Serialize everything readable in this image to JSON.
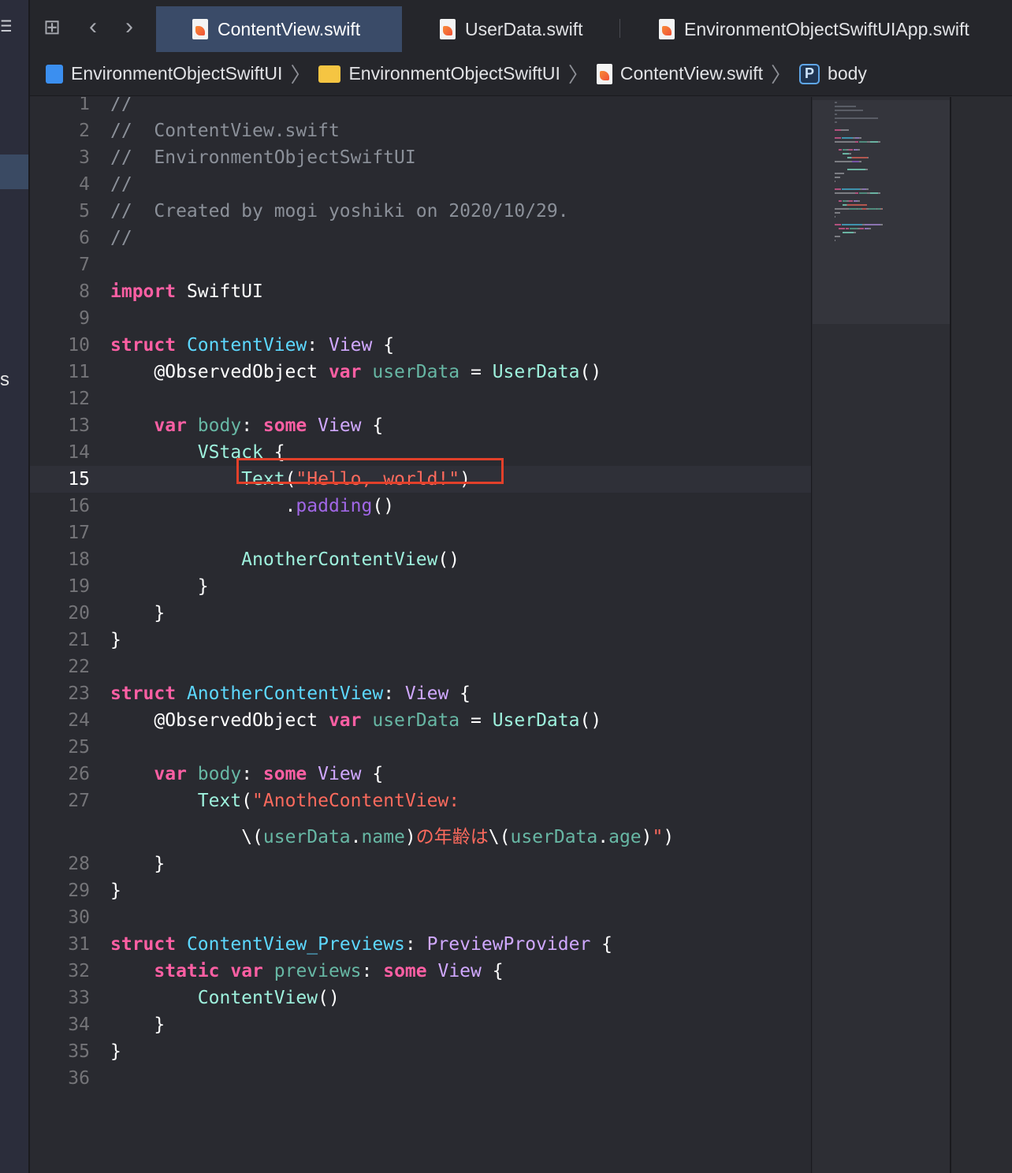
{
  "tabs": [
    {
      "label": "ContentView.swift",
      "active": true
    },
    {
      "label": "UserData.swift",
      "active": false
    },
    {
      "label": "EnvironmentObjectSwiftUIApp.swift",
      "active": false
    }
  ],
  "toolbar_icons": [
    "grid-icon",
    "back-chevron-icon",
    "forward-chevron-icon"
  ],
  "breadcrumb": [
    "EnvironmentObjectSwiftUI",
    "EnvironmentObjectSwiftUI",
    "ContentView.swift",
    "body"
  ],
  "breadcrumb_symbol_letter": "P",
  "left_rail_text": "s",
  "current_line": "15",
  "colors": {
    "keyword": "#fc5fa3",
    "type": "#5dd8ff",
    "string": "#fc6a5d",
    "comment": "#8b9099",
    "highlight_box": "#e2402a",
    "active_tab": "#3a4b68"
  },
  "code": [
    {
      "n": "1",
      "t": [
        [
          "c-com",
          "//"
        ]
      ]
    },
    {
      "n": "2",
      "t": [
        [
          "c-com",
          "//  ContentView.swift"
        ]
      ]
    },
    {
      "n": "3",
      "t": [
        [
          "c-com",
          "//  EnvironmentObjectSwiftUI"
        ]
      ]
    },
    {
      "n": "4",
      "t": [
        [
          "c-com",
          "//"
        ]
      ]
    },
    {
      "n": "5",
      "t": [
        [
          "c-com",
          "//  Created by mogi yoshiki on 2020/10/29."
        ]
      ]
    },
    {
      "n": "6",
      "t": [
        [
          "c-com",
          "//"
        ]
      ]
    },
    {
      "n": "7",
      "t": []
    },
    {
      "n": "8",
      "t": [
        [
          "c-kw",
          "import"
        ],
        [
          "c-plain",
          " SwiftUI"
        ]
      ]
    },
    {
      "n": "9",
      "t": []
    },
    {
      "n": "10",
      "t": [
        [
          "c-kw",
          "struct"
        ],
        [
          "c-plain",
          " "
        ],
        [
          "c-type",
          "ContentView"
        ],
        [
          "c-plain",
          ": "
        ],
        [
          "c-type2",
          "View"
        ],
        [
          "c-plain",
          " {"
        ]
      ]
    },
    {
      "n": "11",
      "t": [
        [
          "c-plain",
          "    @ObservedObject "
        ],
        [
          "c-kw",
          "var"
        ],
        [
          "c-plain",
          " "
        ],
        [
          "c-var",
          "userData"
        ],
        [
          "c-plain",
          " = "
        ],
        [
          "c-call",
          "UserData"
        ],
        [
          "c-plain",
          "()"
        ]
      ]
    },
    {
      "n": "12",
      "t": []
    },
    {
      "n": "13",
      "t": [
        [
          "c-plain",
          "    "
        ],
        [
          "c-kw",
          "var"
        ],
        [
          "c-plain",
          " "
        ],
        [
          "c-var",
          "body"
        ],
        [
          "c-plain",
          ": "
        ],
        [
          "c-kw",
          "some"
        ],
        [
          "c-plain",
          " "
        ],
        [
          "c-type2",
          "View"
        ],
        [
          "c-plain",
          " {"
        ]
      ]
    },
    {
      "n": "14",
      "t": [
        [
          "c-plain",
          "        "
        ],
        [
          "c-call",
          "VStack"
        ],
        [
          "c-plain",
          " {"
        ]
      ]
    },
    {
      "n": "15",
      "t": [
        [
          "c-plain",
          "            "
        ],
        [
          "c-call",
          "Text"
        ],
        [
          "c-plain",
          "("
        ],
        [
          "c-str",
          "\"Hello, world!\""
        ],
        [
          "c-plain",
          ")"
        ]
      ]
    },
    {
      "n": "16",
      "t": [
        [
          "c-plain",
          "                ."
        ],
        [
          "c-fn",
          "padding"
        ],
        [
          "c-plain",
          "()"
        ]
      ]
    },
    {
      "n": "17",
      "t": []
    },
    {
      "n": "18",
      "t": [
        [
          "c-plain",
          "            "
        ],
        [
          "c-call",
          "AnotherContentView"
        ],
        [
          "c-plain",
          "()"
        ]
      ]
    },
    {
      "n": "19",
      "t": [
        [
          "c-plain",
          "        }"
        ]
      ]
    },
    {
      "n": "20",
      "t": [
        [
          "c-plain",
          "    }"
        ]
      ]
    },
    {
      "n": "21",
      "t": [
        [
          "c-plain",
          "}"
        ]
      ]
    },
    {
      "n": "22",
      "t": []
    },
    {
      "n": "23",
      "t": [
        [
          "c-kw",
          "struct"
        ],
        [
          "c-plain",
          " "
        ],
        [
          "c-type",
          "AnotherContentView"
        ],
        [
          "c-plain",
          ": "
        ],
        [
          "c-type2",
          "View"
        ],
        [
          "c-plain",
          " {"
        ]
      ]
    },
    {
      "n": "24",
      "t": [
        [
          "c-plain",
          "    @ObservedObject "
        ],
        [
          "c-kw",
          "var"
        ],
        [
          "c-plain",
          " "
        ],
        [
          "c-var",
          "userData"
        ],
        [
          "c-plain",
          " = "
        ],
        [
          "c-call",
          "UserData"
        ],
        [
          "c-plain",
          "()"
        ]
      ]
    },
    {
      "n": "25",
      "t": []
    },
    {
      "n": "26",
      "t": [
        [
          "c-plain",
          "    "
        ],
        [
          "c-kw",
          "var"
        ],
        [
          "c-plain",
          " "
        ],
        [
          "c-var",
          "body"
        ],
        [
          "c-plain",
          ": "
        ],
        [
          "c-kw",
          "some"
        ],
        [
          "c-plain",
          " "
        ],
        [
          "c-type2",
          "View"
        ],
        [
          "c-plain",
          " {"
        ]
      ]
    },
    {
      "n": "27",
      "t": [
        [
          "c-plain",
          "        "
        ],
        [
          "c-call",
          "Text"
        ],
        [
          "c-plain",
          "("
        ],
        [
          "c-str",
          "\"AnotheContentView:"
        ]
      ]
    },
    {
      "n": "",
      "t": [
        [
          "c-plain",
          "            \\("
        ],
        [
          "c-var",
          "userData"
        ],
        [
          "c-plain",
          "."
        ],
        [
          "c-var",
          "name"
        ],
        [
          "c-plain",
          ")"
        ],
        [
          "c-str",
          "の年齢は"
        ],
        [
          "c-plain",
          "\\("
        ],
        [
          "c-var",
          "userData"
        ],
        [
          "c-plain",
          "."
        ],
        [
          "c-var",
          "age"
        ],
        [
          "c-plain",
          ")"
        ],
        [
          "c-str",
          "\""
        ],
        [
          "c-plain",
          ")"
        ]
      ]
    },
    {
      "n": "28",
      "t": [
        [
          "c-plain",
          "    }"
        ]
      ]
    },
    {
      "n": "29",
      "t": [
        [
          "c-plain",
          "}"
        ]
      ]
    },
    {
      "n": "30",
      "t": []
    },
    {
      "n": "31",
      "t": [
        [
          "c-kw",
          "struct"
        ],
        [
          "c-plain",
          " "
        ],
        [
          "c-type",
          "ContentView_Previews"
        ],
        [
          "c-plain",
          ": "
        ],
        [
          "c-type2",
          "PreviewProvider"
        ],
        [
          "c-plain",
          " {"
        ]
      ]
    },
    {
      "n": "32",
      "t": [
        [
          "c-plain",
          "    "
        ],
        [
          "c-kw",
          "static"
        ],
        [
          "c-plain",
          " "
        ],
        [
          "c-kw",
          "var"
        ],
        [
          "c-plain",
          " "
        ],
        [
          "c-var",
          "previews"
        ],
        [
          "c-plain",
          ": "
        ],
        [
          "c-kw",
          "some"
        ],
        [
          "c-plain",
          " "
        ],
        [
          "c-type2",
          "View"
        ],
        [
          "c-plain",
          " {"
        ]
      ]
    },
    {
      "n": "33",
      "t": [
        [
          "c-plain",
          "        "
        ],
        [
          "c-call",
          "ContentView"
        ],
        [
          "c-plain",
          "()"
        ]
      ]
    },
    {
      "n": "34",
      "t": [
        [
          "c-plain",
          "    }"
        ]
      ]
    },
    {
      "n": "35",
      "t": [
        [
          "c-plain",
          "}"
        ]
      ]
    },
    {
      "n": "36",
      "t": []
    }
  ]
}
